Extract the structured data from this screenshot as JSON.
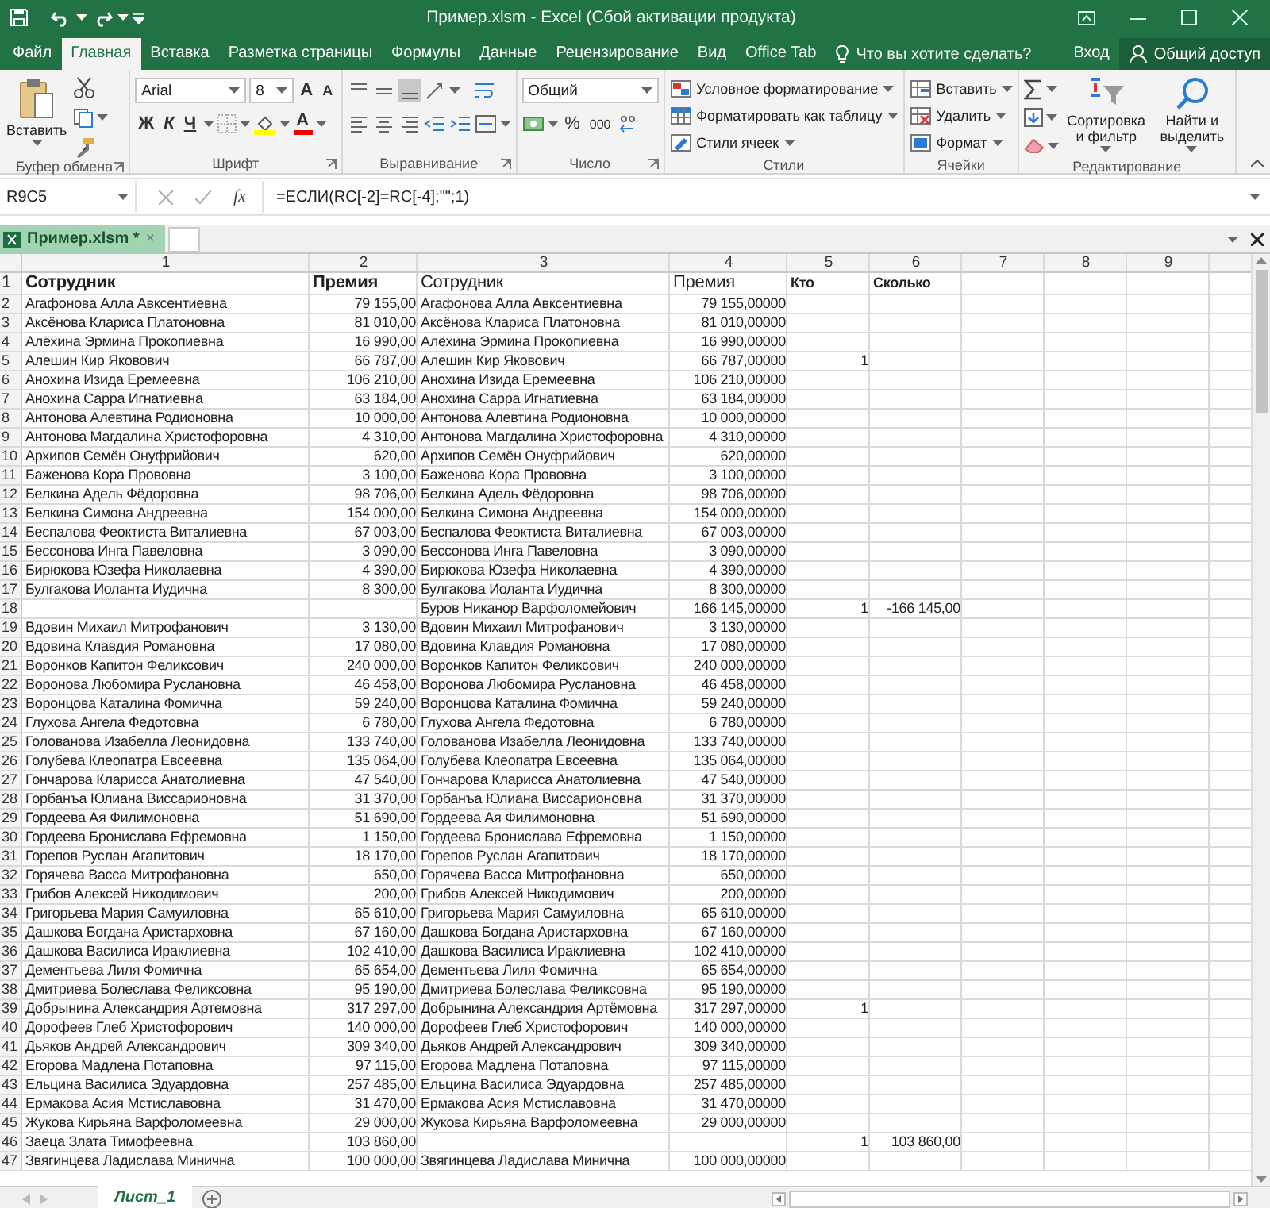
{
  "window": {
    "title": "Пример.xlsm - Excel (Сбой активации продукта)"
  },
  "tabs": [
    {
      "label": "Файл",
      "selected": false
    },
    {
      "label": "Главная",
      "selected": true
    },
    {
      "label": "Вставка",
      "selected": false
    },
    {
      "label": "Разметка страницы",
      "selected": false
    },
    {
      "label": "Формулы",
      "selected": false
    },
    {
      "label": "Данные",
      "selected": false
    },
    {
      "label": "Рецензирование",
      "selected": false
    },
    {
      "label": "Вид",
      "selected": false
    },
    {
      "label": "Office Tab",
      "selected": false
    }
  ],
  "tell_me": {
    "placeholder": "Что вы хотите сделать?"
  },
  "sign_in": "Вход",
  "share": "Общий доступ",
  "ribbon": {
    "clipboard": {
      "paste": "Вставить",
      "label": "Буфер обмена"
    },
    "font": {
      "name": "Arial",
      "size": "8",
      "grow": "A",
      "shrink": "A",
      "bold": "Ж",
      "italic": "К",
      "underline": "Ч",
      "color_letter": "A",
      "label": "Шрифт"
    },
    "alignment": {
      "label": "Выравнивание"
    },
    "number": {
      "format": "Общий",
      "percent": "%",
      "thousands": "000",
      "label": "Число"
    },
    "styles": {
      "items": [
        "Условное форматирование",
        "Форматировать как таблицу",
        "Стили ячеек"
      ],
      "label": "Стили"
    },
    "cells": {
      "items": [
        "Вставить",
        "Удалить",
        "Формат"
      ],
      "label": "Ячейки"
    },
    "editing": {
      "sort": "Сортировка и фильтр",
      "find": "Найти и выделить",
      "label": "Редактирование"
    }
  },
  "formula_bar": {
    "name_box": "R9C5",
    "function_label": "fx",
    "formula": "=ЕСЛИ(RC[-2]=RC[-4];\"\";1)"
  },
  "workbook_tab": {
    "label": "Пример.xlsm *",
    "close": "×"
  },
  "columns": [
    "1",
    "2",
    "3",
    "4",
    "5",
    "6",
    "7",
    "8",
    "9"
  ],
  "rows": [
    {
      "n": "1",
      "cells": [
        "Сотрудник",
        "Премия",
        "Сотрудник",
        "Премия",
        "Кто",
        "Сколько"
      ]
    },
    {
      "n": "2",
      "cells": [
        "Агафонова Алла Авксентиевна",
        "79 155,00",
        "Агафонова Алла Авксентиевна",
        "79 155,00000",
        null,
        null
      ]
    },
    {
      "n": "3",
      "cells": [
        "Аксёнова Клариса Платоновна",
        "81 010,00",
        "Аксёнова Клариса Платоновна",
        "81 010,00000",
        null,
        null
      ]
    },
    {
      "n": "4",
      "cells": [
        "Алёхина Эрмина Прокопиевна",
        "16 990,00",
        "Алёхина Эрмина Прокопиевна",
        "16 990,00000",
        null,
        null
      ]
    },
    {
      "n": "5",
      "cells": [
        "Алешин Кир Яковович",
        "66 787,00",
        "Алешин Кир Яковович",
        "66 787,00000",
        "1",
        null
      ]
    },
    {
      "n": "6",
      "cells": [
        "Анохина Изида Еремеевна",
        "106 210,00",
        "Анохина Изида Еремеевна",
        "106 210,00000",
        null,
        null
      ]
    },
    {
      "n": "7",
      "cells": [
        "Анохина Сарра Игнатиевна",
        "63 184,00",
        "Анохина Сарра Игнатиевна",
        "63 184,00000",
        null,
        null
      ]
    },
    {
      "n": "8",
      "cells": [
        "Антонова Алевтина Родионовна",
        "10 000,00",
        "Антонова Алевтина Родионовна",
        "10 000,00000",
        null,
        null
      ]
    },
    {
      "n": "9",
      "cells": [
        "Антонова Магдалина Христофоровна",
        "4 310,00",
        "Антонова Магдалина Христофоровна",
        "4 310,00000",
        null,
        null
      ]
    },
    {
      "n": "10",
      "cells": [
        "Архипов Семён Онуфрийович",
        "620,00",
        "Архипов Семён Онуфрийович",
        "620,00000",
        null,
        null
      ]
    },
    {
      "n": "11",
      "cells": [
        "Баженова Кора Прововна",
        "3 100,00",
        "Баженова Кора Прововна",
        "3 100,00000",
        null,
        null
      ]
    },
    {
      "n": "12",
      "cells": [
        "Белкина Адель Фёдоровна",
        "98 706,00",
        "Белкина Адель Фёдоровна",
        "98 706,00000",
        null,
        null
      ]
    },
    {
      "n": "13",
      "cells": [
        "Белкина Симона Андреевна",
        "154 000,00",
        "Белкина Симона Андреевна",
        "154 000,00000",
        null,
        null
      ]
    },
    {
      "n": "14",
      "cells": [
        "Беспалова Феоктиста Виталиевна",
        "67 003,00",
        "Беспалова Феоктиста Виталиевна",
        "67 003,00000",
        null,
        null
      ]
    },
    {
      "n": "15",
      "cells": [
        "Бессонова Инга Павеловна",
        "3 090,00",
        "Бессонова Инга Павеловна",
        "3 090,00000",
        null,
        null
      ]
    },
    {
      "n": "16",
      "cells": [
        "Бирюкова Юзефа Николаевна",
        "4 390,00",
        "Бирюкова Юзефа Николаевна",
        "4 390,00000",
        null,
        null
      ]
    },
    {
      "n": "17",
      "cells": [
        "Булгакова Иоланта Иудична",
        "8 300,00",
        "Булгакова Иоланта Иудична",
        "8 300,00000",
        null,
        null
      ]
    },
    {
      "n": "18",
      "cells": [
        null,
        null,
        "Буров Никанор Варфоломейович",
        "166 145,00000",
        "1",
        "-166 145,00"
      ]
    },
    {
      "n": "19",
      "cells": [
        "Вдовин Михаил Митрофанович",
        "3 130,00",
        "Вдовин Михаил Митрофанович",
        "3 130,00000",
        null,
        null
      ]
    },
    {
      "n": "20",
      "cells": [
        "Вдовина Клавдия Романовна",
        "17 080,00",
        "Вдовина Клавдия Романовна",
        "17 080,00000",
        null,
        null
      ]
    },
    {
      "n": "21",
      "cells": [
        "Воронков Капитон Феликсович",
        "240 000,00",
        "Воронков Капитон Феликсович",
        "240 000,00000",
        null,
        null
      ]
    },
    {
      "n": "22",
      "cells": [
        "Воронова Любомира Руслановна",
        "46 458,00",
        "Воронова Любомира Руслановна",
        "46 458,00000",
        null,
        null
      ]
    },
    {
      "n": "23",
      "cells": [
        "Воронцова Каталина Фомична",
        "59 240,00",
        "Воронцова Каталина Фомична",
        "59 240,00000",
        null,
        null
      ]
    },
    {
      "n": "24",
      "cells": [
        "Глухова Ангела Федотовна",
        "6 780,00",
        "Глухова Ангела Федотовна",
        "6 780,00000",
        null,
        null
      ]
    },
    {
      "n": "25",
      "cells": [
        "Голованова Изабелла Леонидовна",
        "133 740,00",
        "Голованова Изабелла Леонидовна",
        "133 740,00000",
        null,
        null
      ]
    },
    {
      "n": "26",
      "cells": [
        "Голубева Клеопатра Евсеевна",
        "135 064,00",
        "Голубева Клеопатра Евсеевна",
        "135 064,00000",
        null,
        null
      ]
    },
    {
      "n": "27",
      "cells": [
        "Гончарова Кларисса Анатолиевна",
        "47 540,00",
        "Гончарова Кларисса Анатолиевна",
        "47 540,00000",
        null,
        null
      ]
    },
    {
      "n": "28",
      "cells": [
        "Горбанъа Юлиана Виссарионовна",
        "31 370,00",
        "Горбанъа Юлиана Виссарионовна",
        "31 370,00000",
        null,
        null
      ]
    },
    {
      "n": "29",
      "cells": [
        "Гордеева Ая Филимоновна",
        "51 690,00",
        "Гордеева Ая Филимоновна",
        "51 690,00000",
        null,
        null
      ]
    },
    {
      "n": "30",
      "cells": [
        "Гордеева Бронислава Ефремовна",
        "1 150,00",
        "Гордеева Бронислава Ефремовна",
        "1 150,00000",
        null,
        null
      ]
    },
    {
      "n": "31",
      "cells": [
        "Горепов Руслан Агапитович",
        "18 170,00",
        "Горепов Руслан Агапитович",
        "18 170,00000",
        null,
        null
      ]
    },
    {
      "n": "32",
      "cells": [
        "Горячева Васса Митрофановна",
        "650,00",
        "Горячева Васса Митрофановна",
        "650,00000",
        null,
        null
      ]
    },
    {
      "n": "33",
      "cells": [
        "Грибов Алексей Никодимович",
        "200,00",
        "Грибов Алексей Никодимович",
        "200,00000",
        null,
        null
      ]
    },
    {
      "n": "34",
      "cells": [
        "Григорьева Мария Самуиловна",
        "65 610,00",
        "Григорьева Мария Самуиловна",
        "65 610,00000",
        null,
        null
      ]
    },
    {
      "n": "35",
      "cells": [
        "Дашкова Богдана Аристарховна",
        "67 160,00",
        "Дашкова Богдана Аристарховна",
        "67 160,00000",
        null,
        null
      ]
    },
    {
      "n": "36",
      "cells": [
        "Дашкова Василиса Ираклиевна",
        "102 410,00",
        "Дашкова Василиса Ираклиевна",
        "102 410,00000",
        null,
        null
      ]
    },
    {
      "n": "37",
      "cells": [
        "Дементьева Лиля Фомична",
        "65 654,00",
        "Дементьева Лиля Фомична",
        "65 654,00000",
        null,
        null
      ]
    },
    {
      "n": "38",
      "cells": [
        "Дмитриева Болеслава Феликсовна",
        "95 190,00",
        "Дмитриева Болеслава Феликсовна",
        "95 190,00000",
        null,
        null
      ]
    },
    {
      "n": "39",
      "cells": [
        "Добрынина Александрия Артемовна",
        "317 297,00",
        "Добрынина Александрия Артёмовна",
        "317 297,00000",
        "1",
        null
      ]
    },
    {
      "n": "40",
      "cells": [
        "Дорофеев Глеб Христофорович",
        "140 000,00",
        "Дорофеев Глеб Христофорович",
        "140 000,00000",
        null,
        null
      ]
    },
    {
      "n": "41",
      "cells": [
        "Дьяков Андрей Александрович",
        "309 340,00",
        "Дьяков Андрей Александрович",
        "309 340,00000",
        null,
        null
      ]
    },
    {
      "n": "42",
      "cells": [
        "Егорова Мадлена Потаповна",
        "97 115,00",
        "Егорова Мадлена Потаповна",
        "97 115,00000",
        null,
        null
      ]
    },
    {
      "n": "43",
      "cells": [
        "Ельцина Василиса Эдуардовна",
        "257 485,00",
        "Ельцина Василиса Эдуардовна",
        "257 485,00000",
        null,
        null
      ]
    },
    {
      "n": "44",
      "cells": [
        "Ермакова Асия Мстиславовна",
        "31 470,00",
        "Ермакова Асия Мстиславовна",
        "31 470,00000",
        null,
        null
      ]
    },
    {
      "n": "45",
      "cells": [
        "Жукова Кирьяна Варфоломеевна",
        "29 000,00",
        "Жукова Кирьяна Варфоломеевна",
        "29 000,00000",
        null,
        null
      ]
    },
    {
      "n": "46",
      "cells": [
        "Заеца Злата Тимофеевна",
        "103 860,00",
        null,
        null,
        "1",
        "103 860,00"
      ]
    },
    {
      "n": "47",
      "cells": [
        "Звягинцева Ладислава Минична",
        "100 000,00",
        "Звягинцева Ладислава Минична",
        "100 000,00000",
        null,
        null
      ]
    }
  ],
  "sheets": [
    {
      "label": "Лист_1",
      "selected": true
    }
  ]
}
